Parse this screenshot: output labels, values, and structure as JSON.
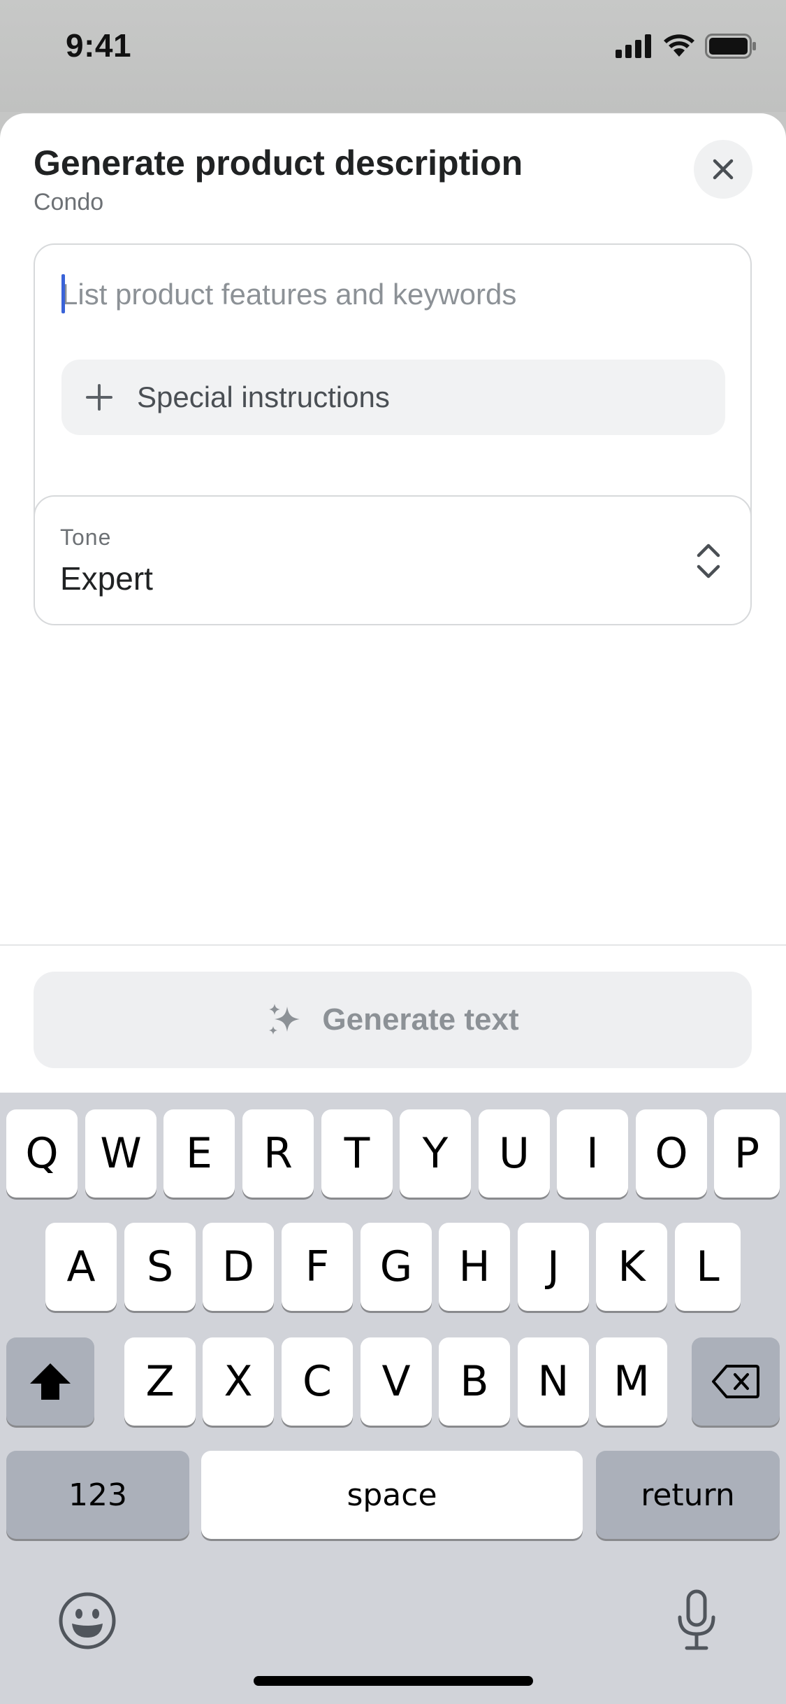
{
  "status_bar": {
    "time": "9:41"
  },
  "sheet": {
    "title": "Generate product description",
    "subtitle": "Condo",
    "input": {
      "placeholder": "List product features and keywords"
    },
    "special_instructions_label": "Special instructions",
    "tone": {
      "label": "Tone",
      "value": "Expert"
    },
    "generate_label": "Generate text"
  },
  "keyboard": {
    "row1": [
      "Q",
      "W",
      "E",
      "R",
      "T",
      "Y",
      "U",
      "I",
      "O",
      "P"
    ],
    "row2": [
      "A",
      "S",
      "D",
      "F",
      "G",
      "H",
      "J",
      "K",
      "L"
    ],
    "row3": [
      "Z",
      "X",
      "C",
      "V",
      "B",
      "N",
      "M"
    ],
    "numbers_label": "123",
    "space_label": "space",
    "return_label": "return"
  },
  "colors": {
    "accent_caret": "#3a63d8",
    "keyboard_bg": "#d1d3d9",
    "key_dark": "#abb0ba"
  },
  "icons": [
    "signal-icon",
    "wifi-icon",
    "battery-icon",
    "close-icon",
    "plus-icon",
    "chevron-updown-icon",
    "sparkle-icon",
    "shift-icon",
    "backspace-icon",
    "emoji-icon",
    "microphone-icon"
  ]
}
